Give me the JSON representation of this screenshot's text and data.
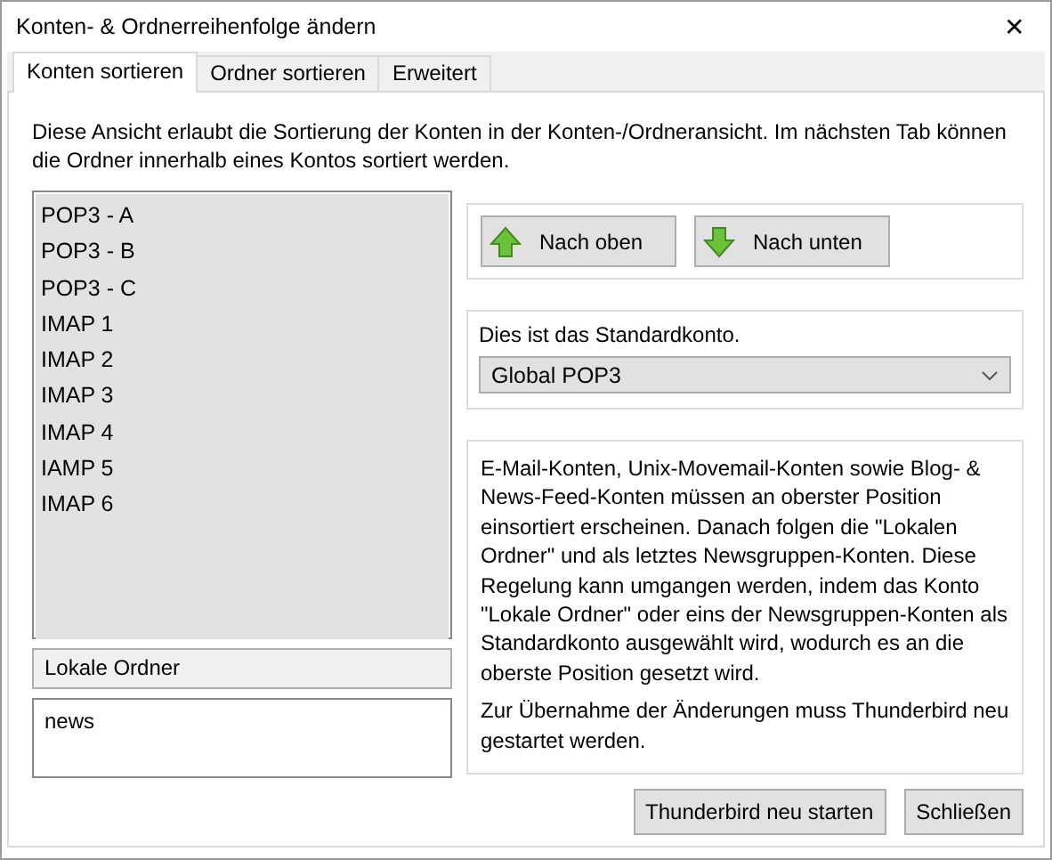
{
  "window": {
    "title": "Konten- & Ordnerreihenfolge ändern",
    "close": "✕"
  },
  "tabs": [
    {
      "label": "Konten sortieren",
      "selected": true
    },
    {
      "label": "Ordner sortieren",
      "selected": false
    },
    {
      "label": "Erweitert",
      "selected": false
    }
  ],
  "description": "Diese Ansicht erlaubt die Sortierung der Konten in der Konten-/Ordneransicht. Im nächsten Tab können die Ordner innerhalb eines Kontos sortiert werden.",
  "accounts": [
    "POP3 - A",
    "POP3 - B",
    "POP3 - C",
    "IMAP 1",
    "IMAP 2",
    "IMAP 3",
    "IMAP 4",
    "IAMP 5",
    "IMAP 6"
  ],
  "local_folders": "Lokale Ordner",
  "news_accounts": [
    "news"
  ],
  "move_buttons": [
    {
      "label": "Nach oben",
      "kind": "up"
    },
    {
      "label": "Nach unten",
      "kind": "down"
    }
  ],
  "default_account": {
    "label": "Dies ist das Standardkonto.",
    "value": "Global POP3"
  },
  "info": [
    "E-Mail-Konten, Unix-Movemail-Konten sowie Blog- & News-Feed-Konten müssen an oberster Position einsortiert erscheinen. Danach folgen die \"Lokalen Ordner\" und als letztes Newsgruppen-Konten. Diese Regelung kann umgangen werden, indem das Konto \"Lokale Ordner\" oder eins der Newsgruppen-Konten als Standardkonto ausgewählt wird, wodurch es an die oberste Position gesetzt wird.",
    "Zur Übernahme der Änderungen muss Thunderbird neu gestartet werden."
  ],
  "buttons": [
    "Thunderbird neu starten",
    "Schließen"
  ]
}
